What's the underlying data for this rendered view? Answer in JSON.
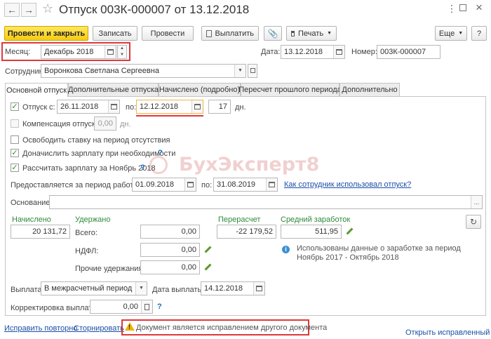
{
  "title": "Отпуск 003К-000007 от 13.12.2018",
  "toolbar": {
    "post_close": "Провести и закрыть",
    "save": "Записать",
    "post": "Провести",
    "pay": "Выплатить",
    "print": "Печать",
    "more": "Еще",
    "help": "?"
  },
  "header": {
    "month_label": "Месяц:",
    "month_value": "Декабрь 2018",
    "date_label": "Дата:",
    "date_value": "13.12.2018",
    "number_label": "Номер:",
    "number_value": "003К-000007",
    "employee_label": "Сотрудник:",
    "employee_value": "Воронкова Светлана Сергеевна"
  },
  "tabs": [
    {
      "label": "Основной отпуск"
    },
    {
      "label": "Дополнительные отпуска"
    },
    {
      "label": "Начислено (подробно)"
    },
    {
      "label": "Пересчет прошлого периода"
    },
    {
      "label": "Дополнительно"
    }
  ],
  "leave": {
    "checkbox_label": "Отпуск",
    "from_label": "с:",
    "from_value": "26.11.2018",
    "to_label": "по:",
    "to_value": "12.12.2018",
    "days_value": "17",
    "days_unit": "дн.",
    "compensation_label": "Компенсация отпуска",
    "compensation_value": "0,00",
    "compensation_unit": "дн.",
    "release_rate_label": "Освободить ставку на период отсутствия",
    "accrue_label": "Доначислить зарплату при необходимости",
    "calc_salary_label": "Рассчитать зарплату за Ноябрь 2018",
    "period_label": "Предоставляется за период работы с:",
    "period_from": "01.09.2018",
    "period_to_label": "по:",
    "period_to": "31.08.2019",
    "how_used_link": "Как сотрудник использовал отпуск?",
    "basis_label": "Основание:",
    "basis_value": ""
  },
  "amounts": {
    "accrued_label": "Начислено",
    "accrued_value": "20 131,72",
    "withheld_label": "Удержано",
    "total_label": "Всего:",
    "total_value": "0,00",
    "ndfl_label": "НДФЛ:",
    "ndfl_value": "0,00",
    "other_label": "Прочие удержания:",
    "other_value": "0,00",
    "recalc_label": "Перерасчет",
    "recalc_value": "-22 179,52",
    "avg_label": "Средний заработок",
    "avg_value": "511,95",
    "info_text_1": "Использованы данные о заработке за период",
    "info_text_2": "Ноябрь 2017 - Октябрь 2018"
  },
  "payment": {
    "payment_label": "Выплата:",
    "payment_value": "В межрасчетный период",
    "pay_date_label": "Дата выплаты:",
    "pay_date_value": "14.12.2018",
    "correction_label": "Корректировка выплаты:",
    "correction_value": "0,00"
  },
  "footer": {
    "fix_again": "Исправить повторно",
    "reverse": "Сторнировать",
    "warning": "Документ является исправлением другого документа",
    "open_fixed": "Открыть исправленный"
  },
  "watermark": "БухЭксперт8",
  "colors": {
    "primary_button": "#f6cc11",
    "highlight_red": "#e0383c",
    "link_blue": "#1b4fa6",
    "label_green": "#2f8a3a"
  }
}
